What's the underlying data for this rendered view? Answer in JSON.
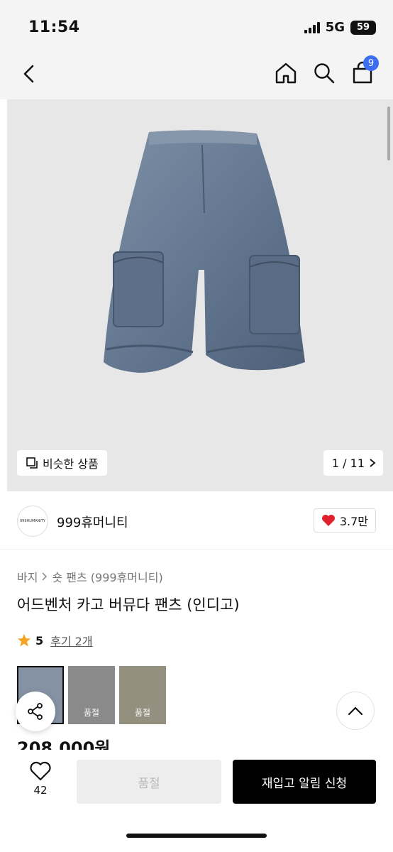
{
  "status": {
    "time": "11:54",
    "network": "5G",
    "battery": "59"
  },
  "header": {
    "cart_count": "9"
  },
  "gallery": {
    "similar_label": "비슷한 상품",
    "counter": "1 / 11"
  },
  "brand": {
    "logo_text": "999HUMANITY",
    "name": "999휴머니티",
    "likes": "3.7만"
  },
  "breadcrumb": [
    "바지",
    "숏 팬츠 (999휴머니티)"
  ],
  "product": {
    "title": "어드벤처 카고 버뮤다 팬츠 (인디고)",
    "rating": "5",
    "reviews": "후기 2개",
    "price": "208,000원"
  },
  "thumbnails": [
    {
      "label": ""
    },
    {
      "label": "품절"
    },
    {
      "label": "품절"
    }
  ],
  "bottom": {
    "wish_count": "42",
    "soldout_label": "품절",
    "restock_label": "재입고 알림 신청"
  },
  "colors": {
    "accent": "#3b6ef0",
    "heart": "#e0202b",
    "star": "#f5a623",
    "product": "#6f8197"
  }
}
